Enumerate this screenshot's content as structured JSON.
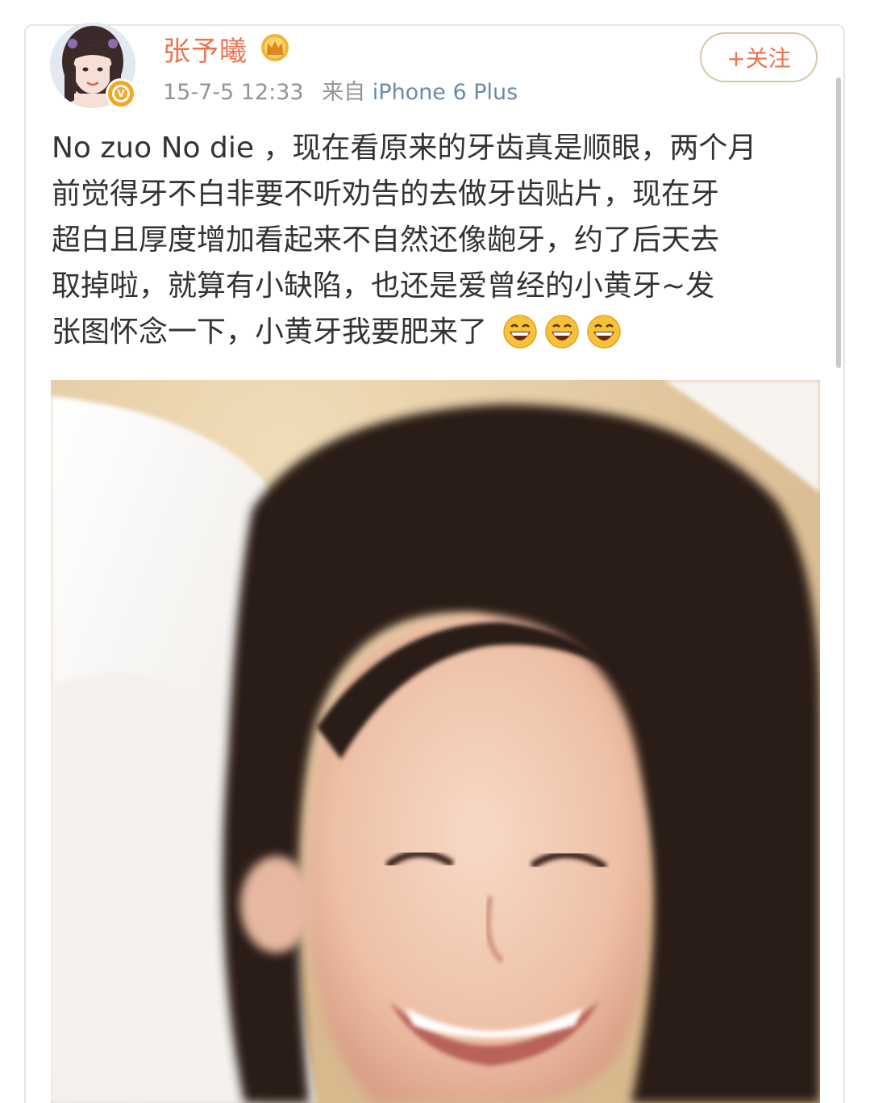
{
  "post": {
    "username": "张予曦",
    "timestamp": "15-7-5 12:33",
    "source_prefix": "来自",
    "device": "iPhone 6 Plus",
    "follow_label": "+关注",
    "text_lines": [
      "No zuo No die ，现在看原来的牙齿真是顺眼，两个月",
      "前觉得牙不白非要不听劝告的去做牙齿贴片，现在牙",
      "超白且厚度增加看起来不自然还像龅牙，约了后天去",
      "取掉啦，就算有小缺陷，也还是爱曾经的小黄牙~发",
      "张图怀念一下，小黄牙我要肥来了"
    ],
    "emoji_count": 3,
    "emoji_icon": "laughing-emoji-icon",
    "verified_icon": "verified-v-badge-icon",
    "member_icon": "crown-icon"
  },
  "colors": {
    "username": "#eb7350",
    "meta": "#939393",
    "text": "#333333",
    "follow_border": "#d7c7a4",
    "verified_badge": "#f5a623"
  }
}
